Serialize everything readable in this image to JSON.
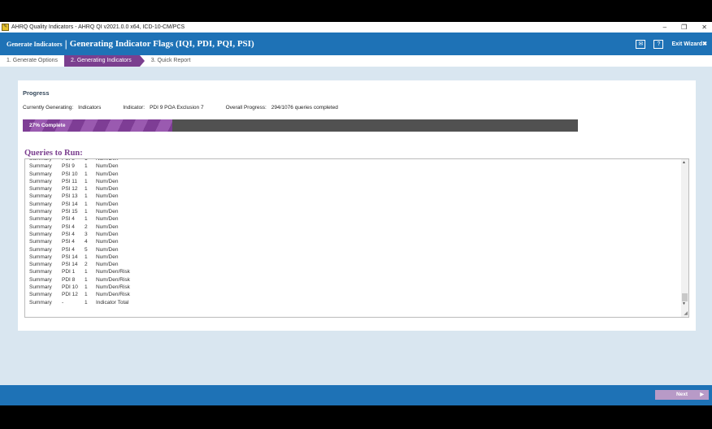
{
  "window": {
    "title": "AHRQ Quality Indicators - AHRQ QI v2021.0.0 x64, ICD-10-CM/PCS",
    "minimize": "–",
    "maximize": "❐",
    "close": "✕"
  },
  "header": {
    "section": "Generate Indicators",
    "separator": "|",
    "title": "Generating Indicator Flags (IQI, PDI, PQI, PSI)",
    "mail_icon": "✉",
    "help_icon": "?",
    "exit_label": "Exit Wizard",
    "exit_icon": "✖"
  },
  "steps": [
    {
      "label": "1. Generate Options"
    },
    {
      "label": "2. Generating Indicators"
    },
    {
      "label": "3. Quick Report"
    }
  ],
  "progress": {
    "heading": "Progress",
    "currently_generating_label": "Currently Generating:",
    "currently_generating_value": "Indicators",
    "indicator_label": "Indicator:",
    "indicator_value": "PDI 9  POA Exclusion 7",
    "overall_label": "Overall Progress:",
    "overall_value": "294/1076 queries completed",
    "bar_label": "27% Complete",
    "fraction": 0.27
  },
  "queries": {
    "heading": "Queries to Run:",
    "rows": [
      [
        "Summary",
        "PSI 8",
        "1",
        "Num/Den"
      ],
      [
        "Summary",
        "PSI 9",
        "1",
        "Num/Den"
      ],
      [
        "Summary",
        "PSI 10",
        "1",
        "Num/Den"
      ],
      [
        "Summary",
        "PSI 11",
        "1",
        "Num/Den"
      ],
      [
        "Summary",
        "PSI 12",
        "1",
        "Num/Den"
      ],
      [
        "Summary",
        "PSI 13",
        "1",
        "Num/Den"
      ],
      [
        "Summary",
        "PSI 14",
        "1",
        "Num/Den"
      ],
      [
        "Summary",
        "PSI 15",
        "1",
        "Num/Den"
      ],
      [
        "Summary",
        "PSI 4",
        "1",
        "Num/Den"
      ],
      [
        "Summary",
        "PSI 4",
        "2",
        "Num/Den"
      ],
      [
        "Summary",
        "PSI 4",
        "3",
        "Num/Den"
      ],
      [
        "Summary",
        "PSI 4",
        "4",
        "Num/Den"
      ],
      [
        "Summary",
        "PSI 4",
        "5",
        "Num/Den"
      ],
      [
        "Summary",
        "PSI 14",
        "1",
        "Num/Den"
      ],
      [
        "Summary",
        "PSI 14",
        "2",
        "Num/Den"
      ],
      [
        "Summary",
        "PDI 1",
        "1",
        "Num/Den/Risk"
      ],
      [
        "Summary",
        "PDI 8",
        "1",
        "Num/Den/Risk"
      ],
      [
        "Summary",
        "PDI 10",
        "1",
        "Num/Den/Risk"
      ],
      [
        "Summary",
        "PDI 12",
        "1",
        "Num/Den/Risk"
      ],
      [
        "Summary",
        "-",
        "1",
        "Indicator Total"
      ]
    ]
  },
  "footer": {
    "next_label": "Next",
    "next_icon": "▶"
  }
}
